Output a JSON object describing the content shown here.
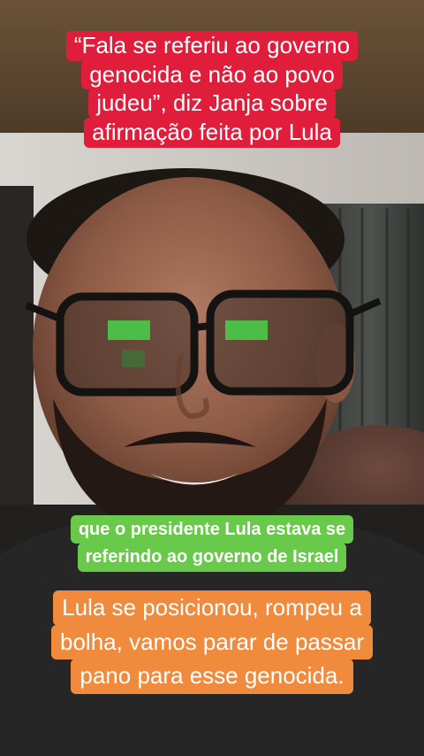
{
  "captions": {
    "top": [
      "“Fala se referiu ao governo",
      "genocida e não ao povo",
      "judeu”, diz Janja sobre",
      "afirmação feita por Lula"
    ],
    "middle": [
      "que o presidente Lula estava se",
      "referindo ao governo de Israel"
    ],
    "bottom": [
      "Lula se posicionou, rompeu a",
      "bolha, vamos parar de passar",
      "pano para esse genocida."
    ]
  },
  "colors": {
    "top_caption_bg": "#e01e3c",
    "middle_caption_bg": "#69c94a",
    "bottom_caption_bg": "#f08a3c",
    "caption_text": "#ffffff"
  }
}
